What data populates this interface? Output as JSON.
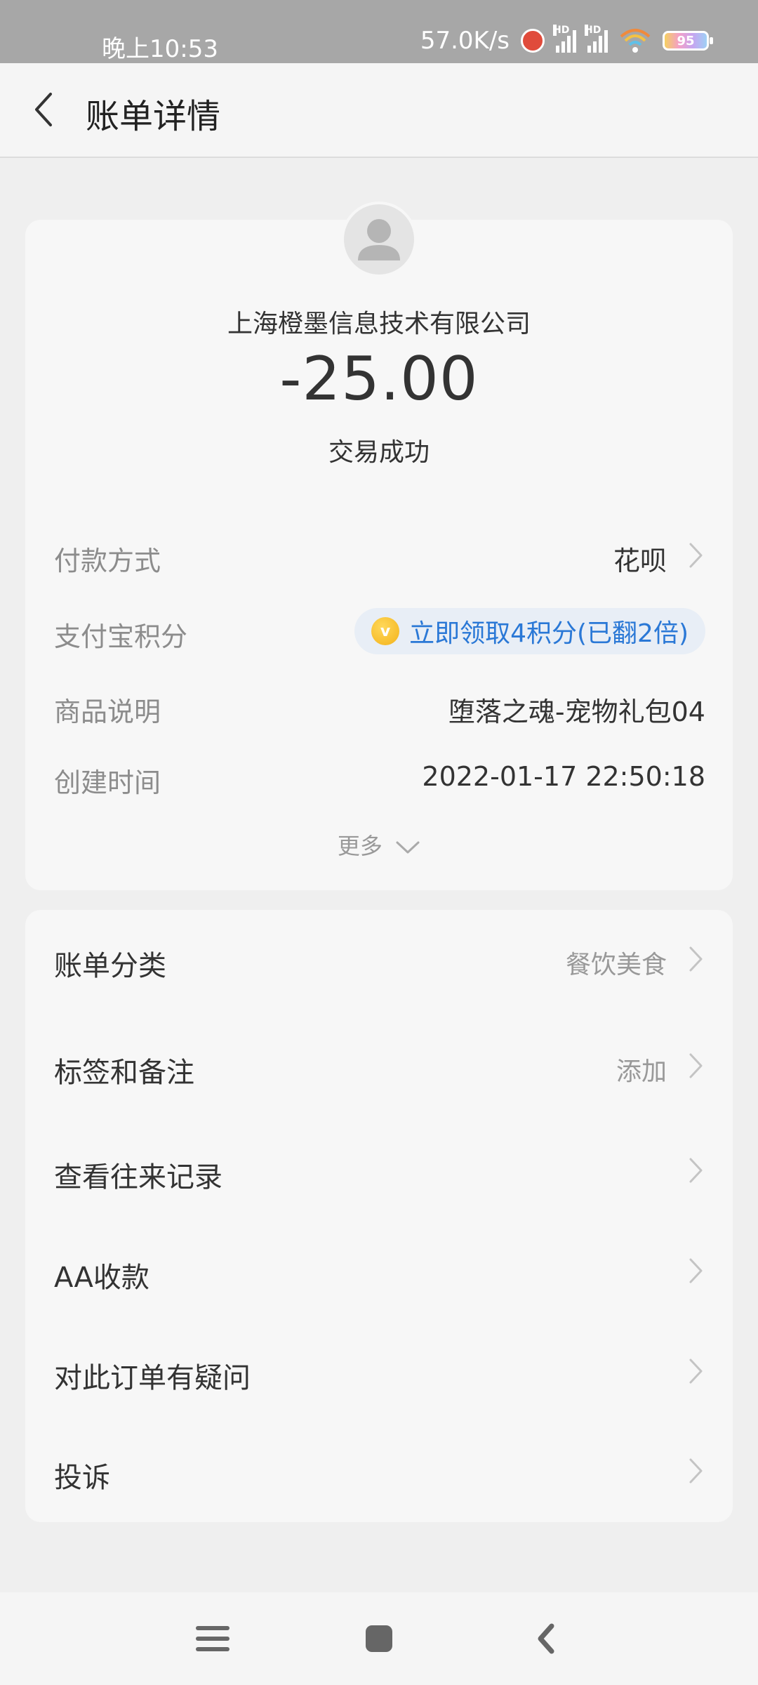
{
  "status_bar": {
    "time": "晚上10:53",
    "speed": "57.0K/s",
    "battery": "95",
    "signal_label": "HD",
    "icons": [
      "alarm-icon",
      "signal-icon",
      "signal-icon",
      "wifi-icon",
      "battery-icon"
    ]
  },
  "header": {
    "title": "账单详情",
    "back_icon": "chevron-left-icon"
  },
  "summary": {
    "merchant": "上海橙墨信息技术有限公司",
    "amount": "-25.00",
    "status": "交易成功"
  },
  "details": {
    "payment_method": {
      "label": "付款方式",
      "value": "花呗"
    },
    "points": {
      "label": "支付宝积分",
      "value": "立即领取4积分(已翻2倍)"
    },
    "product": {
      "label": "商品说明",
      "value": "堕落之魂-宠物礼包04"
    },
    "created": {
      "label": "创建时间",
      "value": "2022-01-17 22:50:18"
    },
    "more": "更多"
  },
  "actions": {
    "category": {
      "label": "账单分类",
      "value": "餐饮美食"
    },
    "tags": {
      "label": "标签和备注",
      "value": "添加"
    },
    "history": {
      "label": "查看往来记录"
    },
    "aa": {
      "label": "AA收款"
    },
    "question": {
      "label": "对此订单有疑问"
    },
    "complaint": {
      "label": "投诉"
    }
  },
  "colors": {
    "accent_blue": "#2a78d6",
    "coin_gold": "#f3b21a",
    "status_bar_bg": "#a7a7a7"
  }
}
